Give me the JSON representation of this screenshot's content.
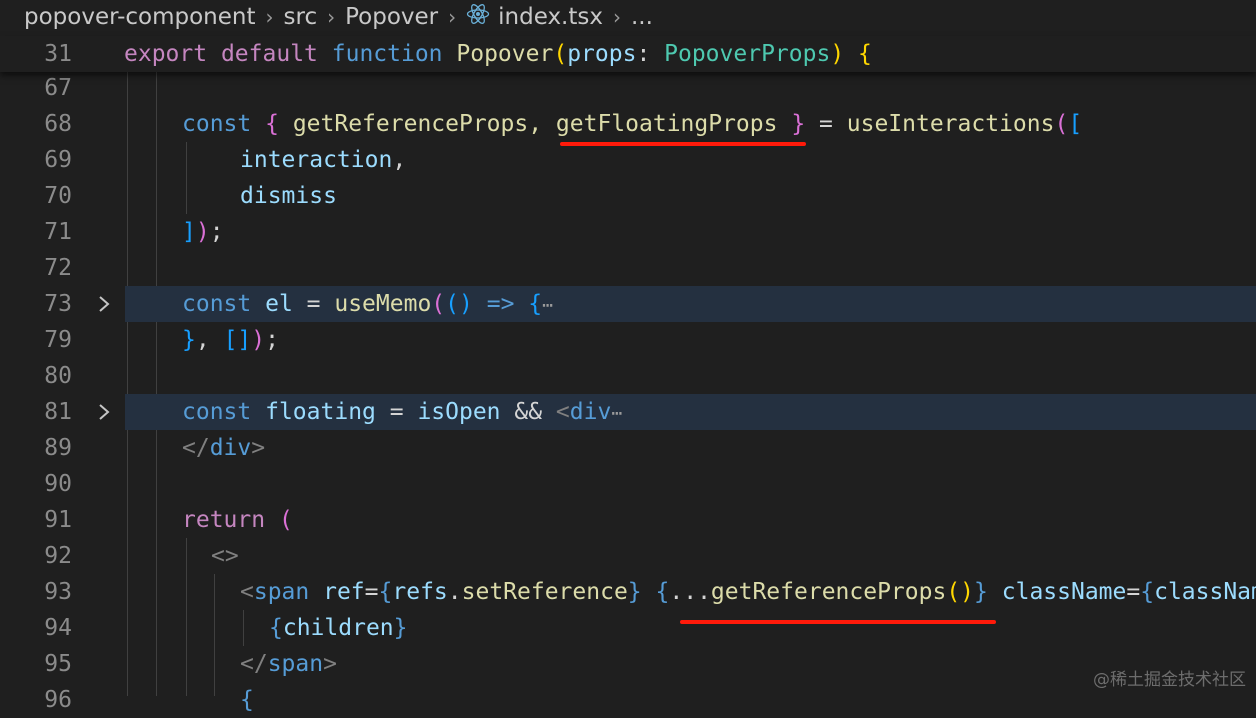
{
  "breadcrumb": {
    "folder": "popover-component",
    "src": "src",
    "sub": "Popover",
    "file": "index.tsx",
    "more": "..."
  },
  "sticky_line": {
    "number": "31",
    "t1": "export",
    "t2": "default",
    "t3": "function",
    "t4": "Popover",
    "t5": "(",
    "t6": "props",
    "t7": ": ",
    "t8": "PopoverProps",
    "t9": ")",
    "t10": " {"
  },
  "lines": {
    "l67": {
      "number": "67"
    },
    "l68": {
      "number": "68",
      "t1": "const",
      "t2": " ",
      "t3": "{",
      "t4": " getReferenceProps, ",
      "t5": "getFloatingProps",
      "t6": " ",
      "t7": "}",
      "t8": " = ",
      "t9": "useInteractions",
      "t10": "(",
      "t11": "["
    },
    "l69": {
      "number": "69",
      "t1": "interaction",
      "t2": ","
    },
    "l70": {
      "number": "70",
      "t1": "dismiss"
    },
    "l71": {
      "number": "71",
      "t1": "]",
      "t2": ")",
      "t3": ";"
    },
    "l72": {
      "number": "72"
    },
    "l73": {
      "number": "73",
      "t1": "const",
      "t2": " ",
      "t3": "el",
      "t4": " = ",
      "t5": "useMemo",
      "t6": "(",
      "t7": "()",
      "t8": " ",
      "t9": "=>",
      "t10": " ",
      "t11": "{",
      "t12": "⋯"
    },
    "l79": {
      "number": "79",
      "t1": "}",
      "t2": ", ",
      "t3": "[]",
      "t4": ")",
      "t5": ";"
    },
    "l80": {
      "number": "80"
    },
    "l81": {
      "number": "81",
      "t1": "const",
      "t2": " ",
      "t3": "floating",
      "t4": " = ",
      "t5": "isOpen",
      "t6": " && ",
      "t7": "<",
      "t8": "div",
      "t9": "⋯"
    },
    "l89": {
      "number": "89",
      "t1": "</",
      "t2": "div",
      "t3": ">"
    },
    "l90": {
      "number": "90"
    },
    "l91": {
      "number": "91",
      "t1": "return",
      "t2": " ",
      "t3": "("
    },
    "l92": {
      "number": "92",
      "t1": "<>"
    },
    "l93": {
      "number": "93",
      "t1": "<",
      "t2": "span",
      "t3": " ",
      "t4": "ref",
      "t5": "=",
      "t6": "{",
      "t7": "refs",
      "t8": ".",
      "t9": "setReference",
      "t10": "}",
      "t11": " ",
      "t12": "{",
      "t13": "...",
      "t14": "getReferenceProps",
      "t15": "()",
      "t16": "}",
      "t17": " ",
      "t18": "className",
      "t19": "=",
      "t20": "{",
      "t21": "className",
      "t22": "}",
      "t23": ">"
    },
    "l94": {
      "number": "94",
      "t1": "{",
      "t2": "children",
      "t3": "}"
    },
    "l95": {
      "number": "95",
      "t1": "</",
      "t2": "span",
      "t3": ">"
    },
    "l96": {
      "number": "96",
      "t1": "{"
    }
  },
  "watermark": "@稀土掘金技术社区"
}
